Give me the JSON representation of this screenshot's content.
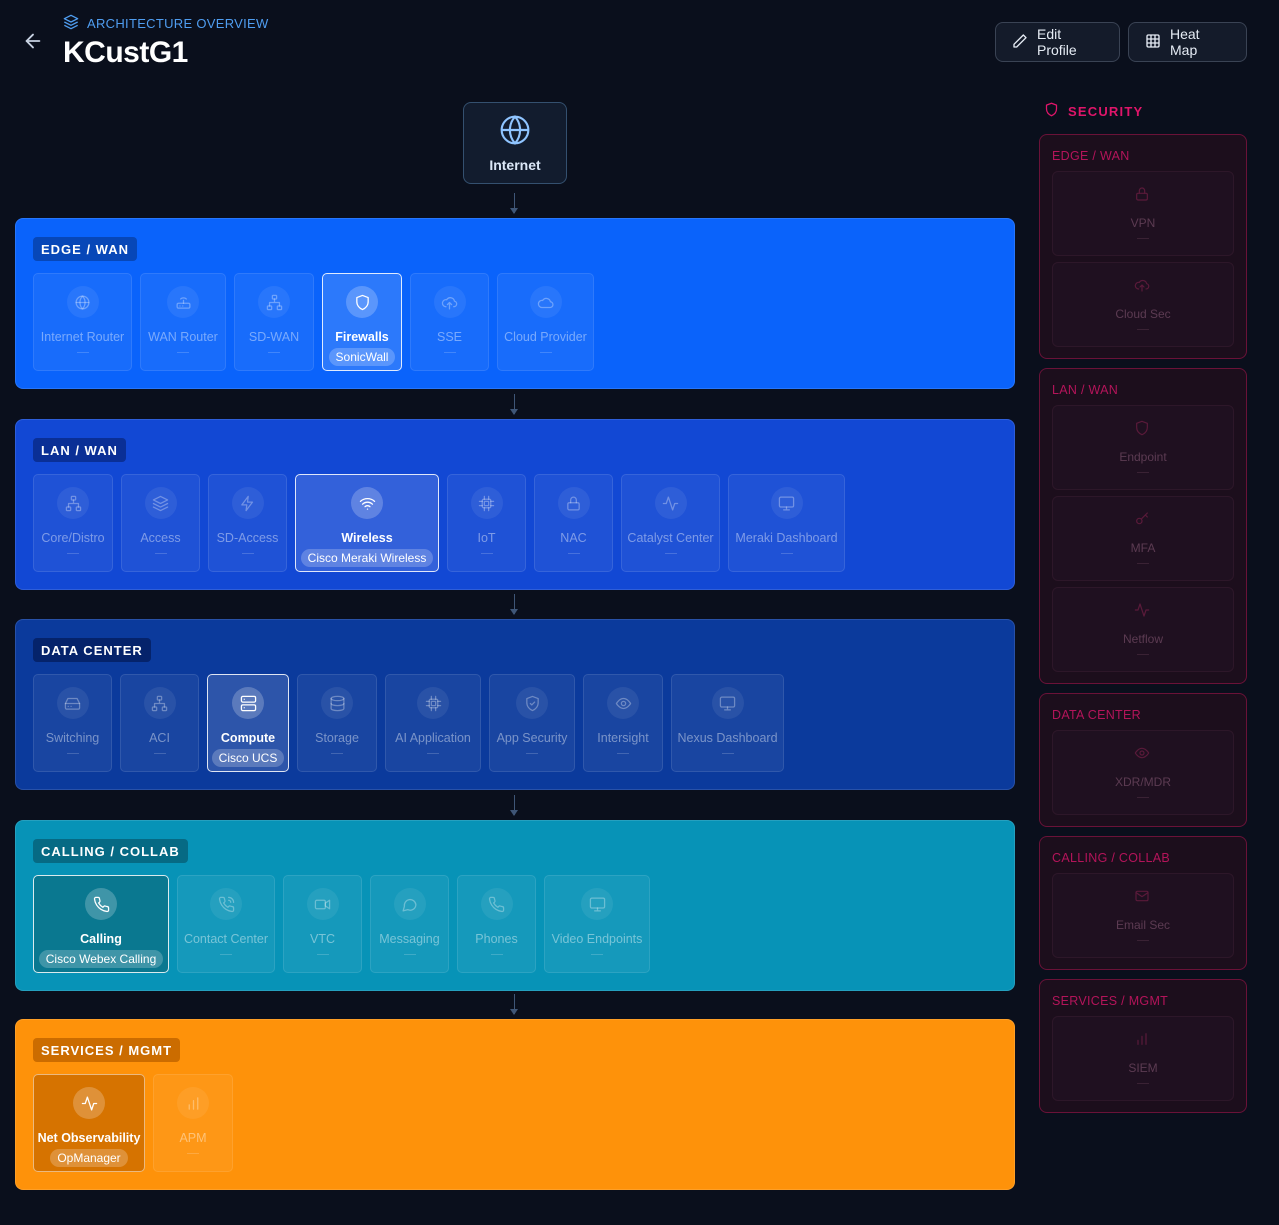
{
  "header": {
    "breadcrumb": "ARCHITECTURE OVERVIEW",
    "title": "KCustG1",
    "edit_profile": "Edit Profile",
    "heat_map": "Heat Map"
  },
  "internet": {
    "label": "Internet"
  },
  "layers": {
    "edge": {
      "label": "EDGE / WAN",
      "tiles": [
        {
          "label": "Internet Router",
          "icon": "globe-icon"
        },
        {
          "label": "WAN Router",
          "icon": "router-icon"
        },
        {
          "label": "SD-WAN",
          "icon": "network-icon"
        },
        {
          "label": "Firewalls",
          "icon": "shield-icon",
          "vendor": "SonicWall"
        },
        {
          "label": "SSE",
          "icon": "cloud-upload-icon"
        },
        {
          "label": "Cloud Provider",
          "icon": "cloud-icon"
        }
      ]
    },
    "lan": {
      "label": "LAN / WAN",
      "tiles": [
        {
          "label": "Core/Distro",
          "icon": "network-icon"
        },
        {
          "label": "Access",
          "icon": "layers-icon"
        },
        {
          "label": "SD-Access",
          "icon": "bolt-icon"
        },
        {
          "label": "Wireless",
          "icon": "wifi-icon",
          "vendor": "Cisco Meraki Wireless"
        },
        {
          "label": "IoT",
          "icon": "chip-icon"
        },
        {
          "label": "NAC",
          "icon": "lock-icon"
        },
        {
          "label": "Catalyst Center",
          "icon": "activity-icon"
        },
        {
          "label": "Meraki Dashboard",
          "icon": "monitor-icon"
        }
      ]
    },
    "dc": {
      "label": "DATA CENTER",
      "tiles": [
        {
          "label": "Switching",
          "icon": "switch-icon"
        },
        {
          "label": "ACI",
          "icon": "network-icon"
        },
        {
          "label": "Compute",
          "icon": "server-icon",
          "vendor": "Cisco UCS"
        },
        {
          "label": "Storage",
          "icon": "database-icon"
        },
        {
          "label": "AI Application",
          "icon": "chip-icon"
        },
        {
          "label": "App Security",
          "icon": "shield-check-icon"
        },
        {
          "label": "Intersight",
          "icon": "eye-icon"
        },
        {
          "label": "Nexus Dashboard",
          "icon": "monitor-icon"
        }
      ]
    },
    "call": {
      "label": "CALLING / COLLAB",
      "tiles": [
        {
          "label": "Calling",
          "icon": "phone-icon",
          "vendor": "Cisco Webex Calling"
        },
        {
          "label": "Contact Center",
          "icon": "phone-call-icon"
        },
        {
          "label": "VTC",
          "icon": "video-icon"
        },
        {
          "label": "Messaging",
          "icon": "message-icon"
        },
        {
          "label": "Phones",
          "icon": "phone-icon"
        },
        {
          "label": "Video Endpoints",
          "icon": "monitor-icon"
        }
      ]
    },
    "svc": {
      "label": "SERVICES / MGMT",
      "tiles": [
        {
          "label": "Net Observability",
          "icon": "activity-icon",
          "vendor": "OpManager"
        },
        {
          "label": "APM",
          "icon": "bar-chart-icon"
        }
      ]
    }
  },
  "security": {
    "title": "SECURITY",
    "groups": [
      {
        "label": "EDGE / WAN",
        "tiles": [
          "VPN",
          "Cloud Sec"
        ]
      },
      {
        "label": "LAN / WAN",
        "tiles": [
          "Endpoint",
          "MFA",
          "Netflow"
        ]
      },
      {
        "label": "DATA CENTER",
        "tiles": [
          "XDR/MDR"
        ]
      },
      {
        "label": "CALLING / COLLAB",
        "tiles": [
          "Email Sec"
        ]
      },
      {
        "label": "SERVICES / MGMT",
        "tiles": [
          "SIEM"
        ]
      }
    ]
  }
}
